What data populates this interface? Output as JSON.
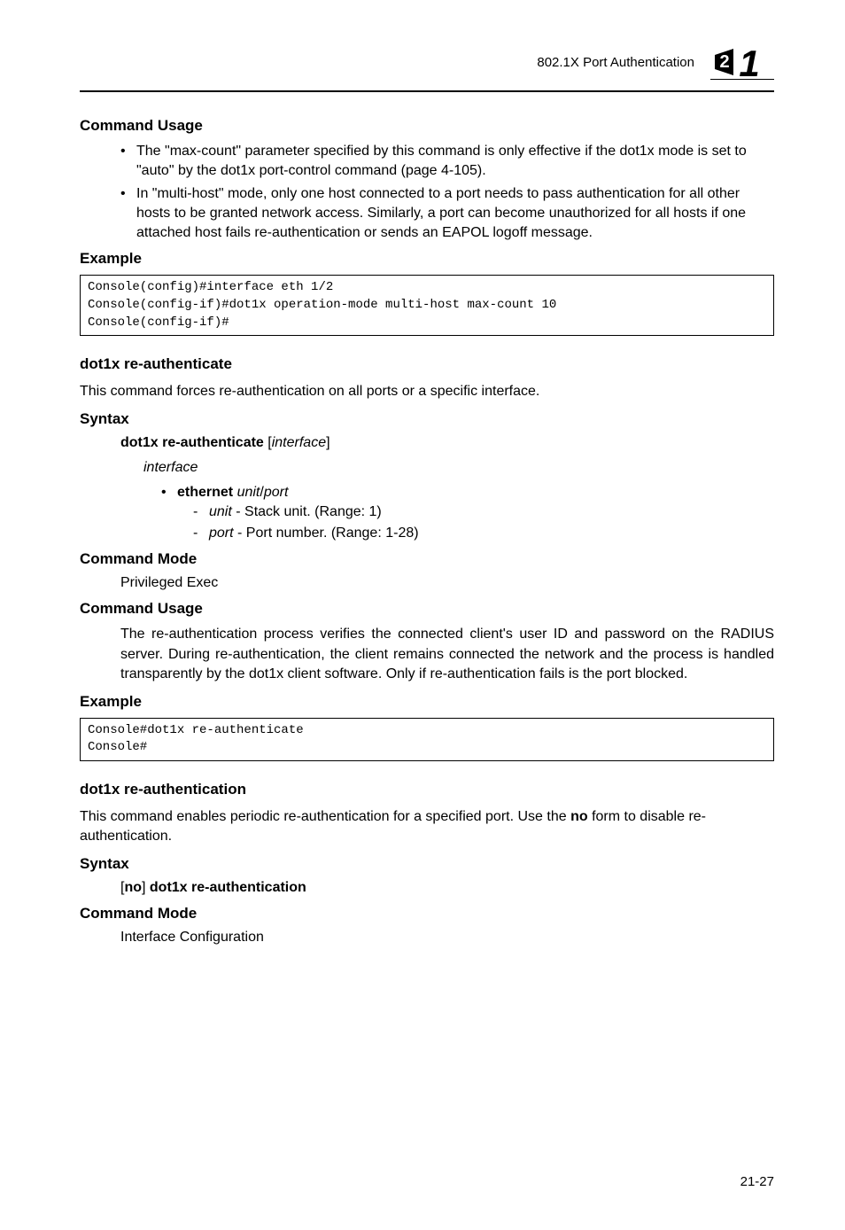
{
  "header": {
    "title": "802.1X Port Authentication",
    "chapter_number": "21"
  },
  "sections": {
    "command_usage_1": {
      "heading": "Command Usage",
      "bullets": [
        "The \"max-count\" parameter specified by this command is only effective if the dot1x mode is set to \"auto\" by the dot1x port-control command (page 4-105).",
        "In \"multi-host\" mode, only one host connected to a port needs to pass authentication for all other hosts to be granted network access. Similarly, a port can become unauthorized for all hosts if one attached host fails re-authentication or sends an EAPOL logoff message."
      ]
    },
    "example_1": {
      "heading": "Example",
      "code": "Console(config)#interface eth 1/2\nConsole(config-if)#dot1x operation-mode multi-host max-count 10 \nConsole(config-if)#"
    },
    "reauthenticate": {
      "heading": "dot1x re-authenticate",
      "desc": "This command forces re-authentication on all ports or a specific interface.",
      "syntax_heading": "Syntax",
      "syntax_cmd_bold": "dot1x re-authenticate",
      "syntax_arg": "interface",
      "interface_label": "interface",
      "ethernet_bold": "ethernet",
      "ethernet_args": "unit",
      "ethernet_sep": "/",
      "ethernet_args2": "port",
      "unit_label": "unit",
      "unit_desc": " - Stack unit. (Range: 1)",
      "port_label": "port",
      "port_desc": " - Port number. (Range: 1-28)",
      "cmd_mode_heading": "Command Mode",
      "cmd_mode_value": "Privileged Exec",
      "cmd_usage_heading": "Command Usage",
      "cmd_usage_text": "The re-authentication process verifies the connected client's user ID and password on the RADIUS server. During re-authentication, the client remains connected the network and the process is handled transparently by the dot1x client software. Only if re-authentication fails is the port blocked.",
      "example_heading": "Example",
      "example_code": "Console#dot1x re-authenticate\nConsole#"
    },
    "reauthentication": {
      "heading": "dot1x re-authentication",
      "desc_pre": "This command enables periodic re-authentication for a specified port. Use the ",
      "desc_bold": "no",
      "desc_post": " form to disable re-authentication.",
      "syntax_heading": "Syntax",
      "syntax_open": "[",
      "syntax_no": "no",
      "syntax_close": "] ",
      "syntax_cmd": "dot1x re-authentication",
      "cmd_mode_heading": "Command Mode",
      "cmd_mode_value": "Interface Configuration"
    }
  },
  "page_number": "21-27"
}
